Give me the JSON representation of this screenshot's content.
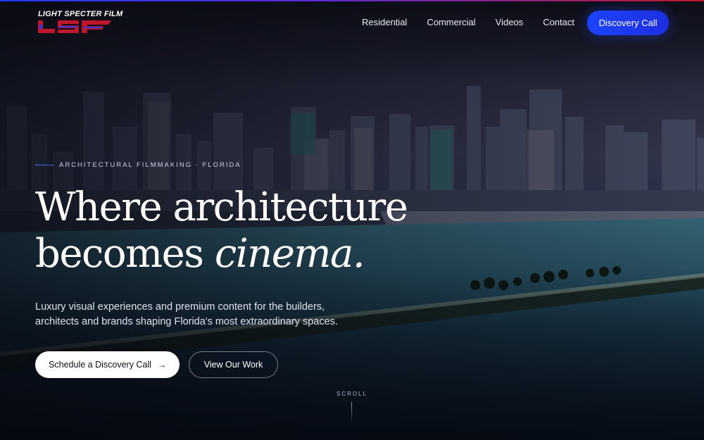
{
  "brand": {
    "name": "LIGHT SPECTER FILM",
    "colors": {
      "red": "#c0162c",
      "blue": "#1e3aff"
    }
  },
  "nav": {
    "items": [
      {
        "label": "Residential"
      },
      {
        "label": "Commercial"
      },
      {
        "label": "Videos"
      },
      {
        "label": "Contact"
      }
    ],
    "cta_label": "Discovery Call",
    "cta_color": "#1d44ff"
  },
  "hero": {
    "eyebrow": "ARCHITECTURAL FILMMAKING · FLORIDA",
    "headline_line1": "Where architecture",
    "headline_line2_plain": "becomes ",
    "headline_line2_italic": "cinema.",
    "subtitle": "Luxury visual experiences and premium content for the builders, architects and brands shaping Florida's most extraordinary spaces.",
    "primary_button": "Schedule a Discovery Call",
    "secondary_button": "View Our Work",
    "scroll_label": "SCROLL",
    "icons": {
      "primary_button_icon": "arrow-right-icon"
    }
  }
}
